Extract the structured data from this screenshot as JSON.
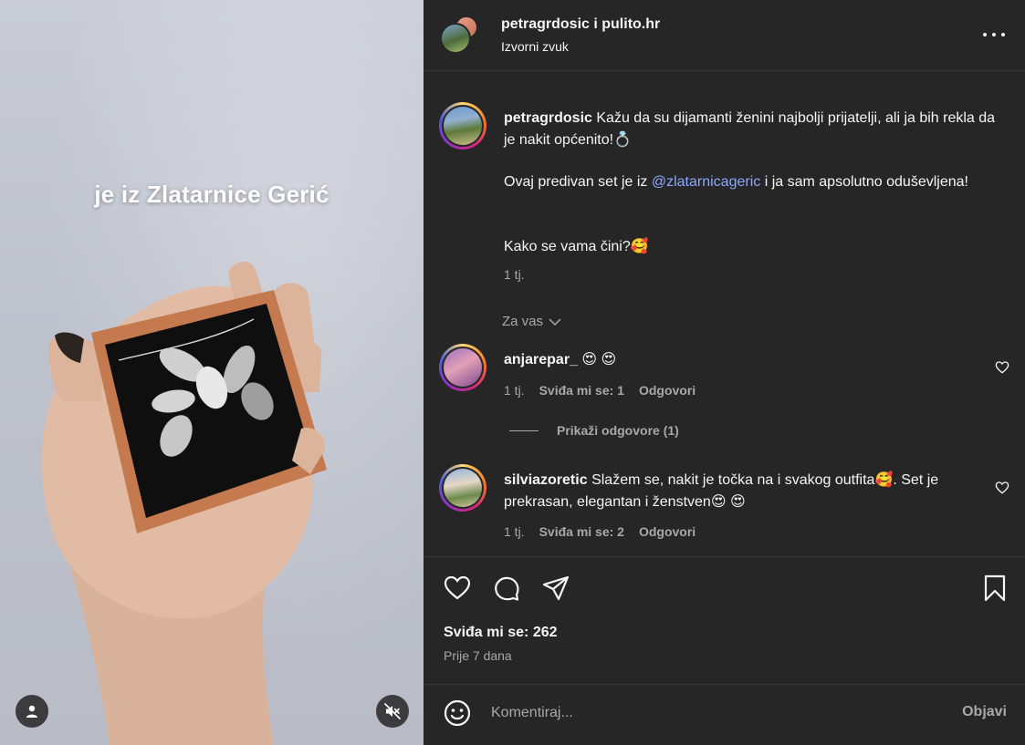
{
  "media": {
    "overlay_text": "je iz Zlatarnice Gerić"
  },
  "header": {
    "names": "petragrdosic i pulito.hr",
    "audio": "Izvorni zvuk"
  },
  "caption": {
    "username": "petragrdosic",
    "line1": "Kažu da su dijamanti ženini najbolji prijatelji, ali ja bih rekla da je nakit općenito!💍",
    "para2_before": "Ovaj predivan set je iz ",
    "mention": "@zlatarnicageric",
    "para2_after": " i ja sam apsolutno oduševljena!",
    "para3": "Kako se vama čini?🥰",
    "time": "1 tj."
  },
  "filter": {
    "label": "Za vas"
  },
  "comments": [
    {
      "username": "anjarepar_",
      "text": "😍 😍",
      "time": "1 tj.",
      "likes": "Sviđa mi se: 1",
      "reply": "Odgovori",
      "view_replies": "Prikaži odgovore (1)"
    },
    {
      "username": "silviazoretic",
      "text": "Slažem se, nakit je točka na i svakog outfita🥰. Set je prekrasan, elegantan i ženstven😍 😍",
      "time": "1 tj.",
      "likes": "Sviđa mi se: 2",
      "reply": "Odgovori"
    }
  ],
  "actions": {
    "likes": "Sviđa mi se: 262",
    "time_ago": "Prije 7 dana"
  },
  "composer": {
    "placeholder": "Komentiraj...",
    "post_label": "Objavi"
  },
  "icons": {
    "user_tag": "user-icon",
    "mute": "speaker-muted-icon",
    "more": "more-horizontal-icon",
    "like": "heart-icon",
    "comment": "comment-bubble-icon",
    "share": "paper-plane-icon",
    "save": "bookmark-icon",
    "emoji": "smiley-icon"
  },
  "colors": {
    "panel_bg": "#262626",
    "text": "#f5f5f5",
    "muted": "#a8a8a8",
    "link": "#8ca7ff"
  }
}
